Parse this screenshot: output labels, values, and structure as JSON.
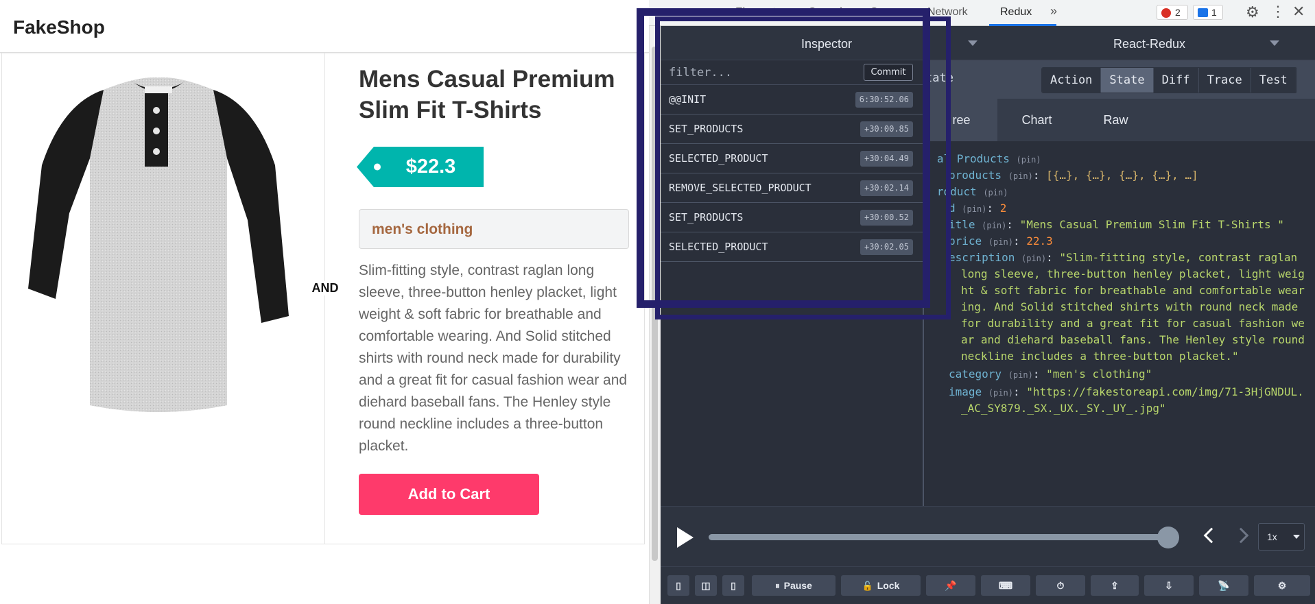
{
  "shop": {
    "brand": "FakeShop",
    "product": {
      "title": "Mens Casual Premium Slim Fit T-Shirts",
      "price": "$22.3",
      "category": "men's clothing",
      "description": "Slim-fitting style, contrast raglan long sleeve, three-button henley placket, light weight & soft fabric for breathable and comfortable wearing. And Solid stitched shirts with round neck made for durability and a great fit for casual fashion wear and diehard baseball fans. The Henley style round neckline includes a three-button placket.",
      "separator_label": "AND",
      "add_to_cart_label": "Add to Cart"
    },
    "colors": {
      "price_tag": "#00b5ad",
      "category_text": "#a5673f",
      "cart_button": "#fe3a6b"
    }
  },
  "devtools": {
    "tabs": [
      "Elements",
      "Console",
      "Sources",
      "Network",
      "Redux"
    ],
    "active_tab": "Redux",
    "more_tabs_icon": "double-chevron-icon",
    "error_count": "2",
    "message_count": "1"
  },
  "redux": {
    "inspector_title": "Inspector",
    "monitor_title": "React-Redux",
    "filter_placeholder": "filter...",
    "commit_label": "Commit",
    "actions": [
      {
        "name": "@@INIT",
        "time": "6:30:52.06"
      },
      {
        "name": "SET_PRODUCTS",
        "time": "+30:00.85"
      },
      {
        "name": "SELECTED_PRODUCT",
        "time": "+30:04.49"
      },
      {
        "name": "REMOVE_SELECTED_PRODUCT",
        "time": "+30:02.14"
      },
      {
        "name": "SET_PRODUCTS",
        "time": "+30:00.52"
      },
      {
        "name": "SELECTED_PRODUCT",
        "time": "+30:02.05"
      }
    ],
    "mode_label": "tate",
    "modes": [
      "Action",
      "State",
      "Diff",
      "Trace",
      "Test"
    ],
    "selected_mode": "State",
    "views": [
      "ree",
      "Chart",
      "Raw"
    ],
    "selected_view": "ree",
    "pin": "(pin)",
    "tree": {
      "all_products_key": "al Products",
      "products_key": "products",
      "products_value": "[{…}, {…}, {…}, {…}, …]",
      "product_key": "roduct",
      "id_key": "d",
      "id_value": "2",
      "title_key": "itle",
      "title_value": "\"Mens Casual Premium Slim Fit T-Shirts \"",
      "price_key": "price",
      "price_value": "22.3",
      "description_key": "escription",
      "description_lines": [
        "\"Slim-fitting style, contrast raglan",
        "long sleeve, three-button henley placket, light weig",
        "ht & soft fabric for breathable and comfortable wear",
        "ing. And Solid stitched shirts with round neck made",
        "for durability and a great fit for casual fashion we",
        "ar and diehard baseball fans. The Henley style round",
        "neckline includes a three-button placket.\""
      ],
      "category_key": "category",
      "category_value": "\"men's clothing\"",
      "image_key": "image",
      "image_lines": [
        "\"https://fakestoreapi.com/img/71-3HjGNDUL.",
        "_AC_SY879._SX._UX._SY._UY_.jpg\""
      ]
    },
    "speed": "1x",
    "pause_label": "Pause",
    "lock_label": "Lock",
    "colors": {
      "bg": "#2a2f3a",
      "key": "#6fb3d2",
      "string": "#b8d66b",
      "number": "#f98c3a",
      "highlight_border": "#25206b"
    }
  }
}
